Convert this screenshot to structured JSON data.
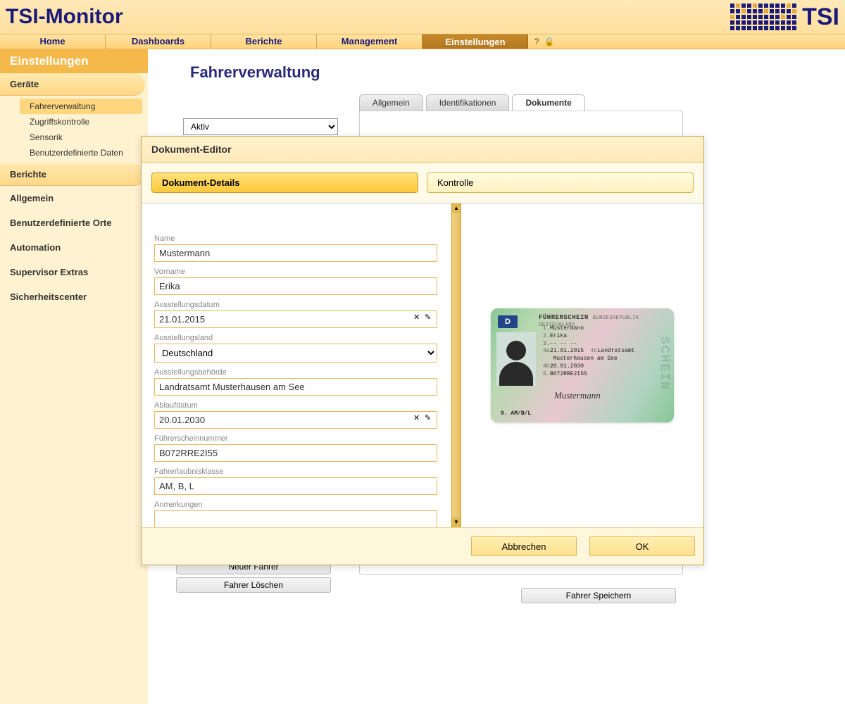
{
  "header": {
    "logo": "TSI-Monitor",
    "logo_right": "TSI"
  },
  "nav": {
    "items": [
      "Home",
      "Dashboards",
      "Berichte",
      "Management",
      "Einstellungen"
    ],
    "active_index": 4,
    "help_icon": "?",
    "lock_icon": "🔒"
  },
  "sidebar": {
    "title": "Einstellungen",
    "section1": "Geräte",
    "sub_items": [
      "Fahrerverwaltung",
      "Zugriffskontrolle",
      "Sensorik",
      "Benutzerdefinierte Daten"
    ],
    "sub_active_index": 0,
    "section2": "Berichte",
    "links": [
      "Allgemein",
      "Benutzerdefinierte Orte",
      "Automation",
      "Supervisor Extras",
      "Sicherheitscenter"
    ]
  },
  "main": {
    "title": "Fahrerverwaltung",
    "filter_value": "Aktiv",
    "tabs": [
      "Allgemein",
      "Identifikationen",
      "Dokumente"
    ],
    "tab_active_index": 2,
    "btn_new": "Neuer Fahrer",
    "btn_delete": "Fahrer Löschen",
    "btn_save": "Fahrer Speichern"
  },
  "modal": {
    "title": "Dokument-Editor",
    "tabs": [
      "Dokument-Details",
      "Kontrolle"
    ],
    "tab_active_index": 0,
    "fields": {
      "name_label": "Name",
      "name_value": "Mustermann",
      "vorname_label": "Vorname",
      "vorname_value": "Erika",
      "ausstellungsdatum_label": "Ausstellungsdatum",
      "ausstellungsdatum_value": "21.01.2015",
      "ausstellungsland_label": "Ausstellungsland",
      "ausstellungsland_value": "Deutschland",
      "ausstellungsbehoerde_label": "Ausstellungsbehörde",
      "ausstellungsbehoerde_value": "Landratsamt Musterhausen am See",
      "ablaufdatum_label": "Ablaufdatum",
      "ablaufdatum_value": "20.01.2030",
      "fuehrerscheinnummer_label": "Führerscheinnummer",
      "fuehrerscheinnummer_value": "B072RRE2I55",
      "fahrerlaubnisklasse_label": "Fahrerlaubnisklasse",
      "fahrerlaubnisklasse_value": "AM, B, L",
      "anmerkungen_label": "Anmerkungen",
      "anmerkungen_value": ""
    },
    "cancel": "Abbrechen",
    "ok": "OK"
  },
  "license": {
    "title": "FÜHRERSCHEIN",
    "country": "BUNDESREPUBLIK DEUTSCHLAND",
    "flag": "D",
    "name": "Mustermann",
    "vorname": "Erika",
    "birth": "-- -- --",
    "issue": "21.01.2015",
    "authority": "Landratsamt",
    "authority2": "Musterhausen am See",
    "expiry": "20.01.2030",
    "number": "B072RRE2I55",
    "classes": "AM/B/L",
    "signature": "Mustermann",
    "watermark": "SCHEIN"
  }
}
